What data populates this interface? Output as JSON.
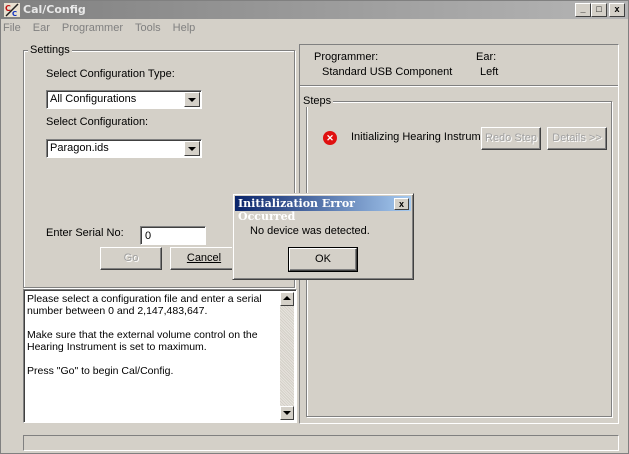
{
  "window": {
    "title": "Cal/Config",
    "icon": "calconfig-app-icon",
    "controls": {
      "minimize": "_",
      "maximize": "□",
      "close": "x"
    }
  },
  "menu": [
    "File",
    "Ear",
    "Programmer",
    "Tools",
    "Help"
  ],
  "settings": {
    "legend": "Settings",
    "config_type_label": "Select Configuration Type:",
    "config_type_value": "All Configurations",
    "config_label": "Select Configuration:",
    "config_value": "Paragon.ids",
    "serial_label": "Enter Serial No:",
    "serial_value": "0",
    "go_label": "Go",
    "cancel_label": "Cancel"
  },
  "info_text": [
    "Please select a configuration file and enter a serial number between 0 and 2,147,483,647.",
    "Make sure that the external volume control on the Hearing Instrument is set to maximum.",
    "Press \"Go\" to begin Cal/Config."
  ],
  "programmer": {
    "programmer_label": "Programmer:",
    "programmer_value": "Standard USB Component",
    "ear_label": "Ear:",
    "ear_value": "Left"
  },
  "steps": {
    "legend": "Steps",
    "status_icon": "error-icon",
    "step_text": "Initializing Hearing Instrument",
    "redo_label": "Redo Step",
    "details_label": "Details >>"
  },
  "dialog": {
    "title": "Initialization Error Occurred",
    "close": "x",
    "message": "No device was detected.",
    "ok_label": "OK"
  },
  "status_bar": ""
}
